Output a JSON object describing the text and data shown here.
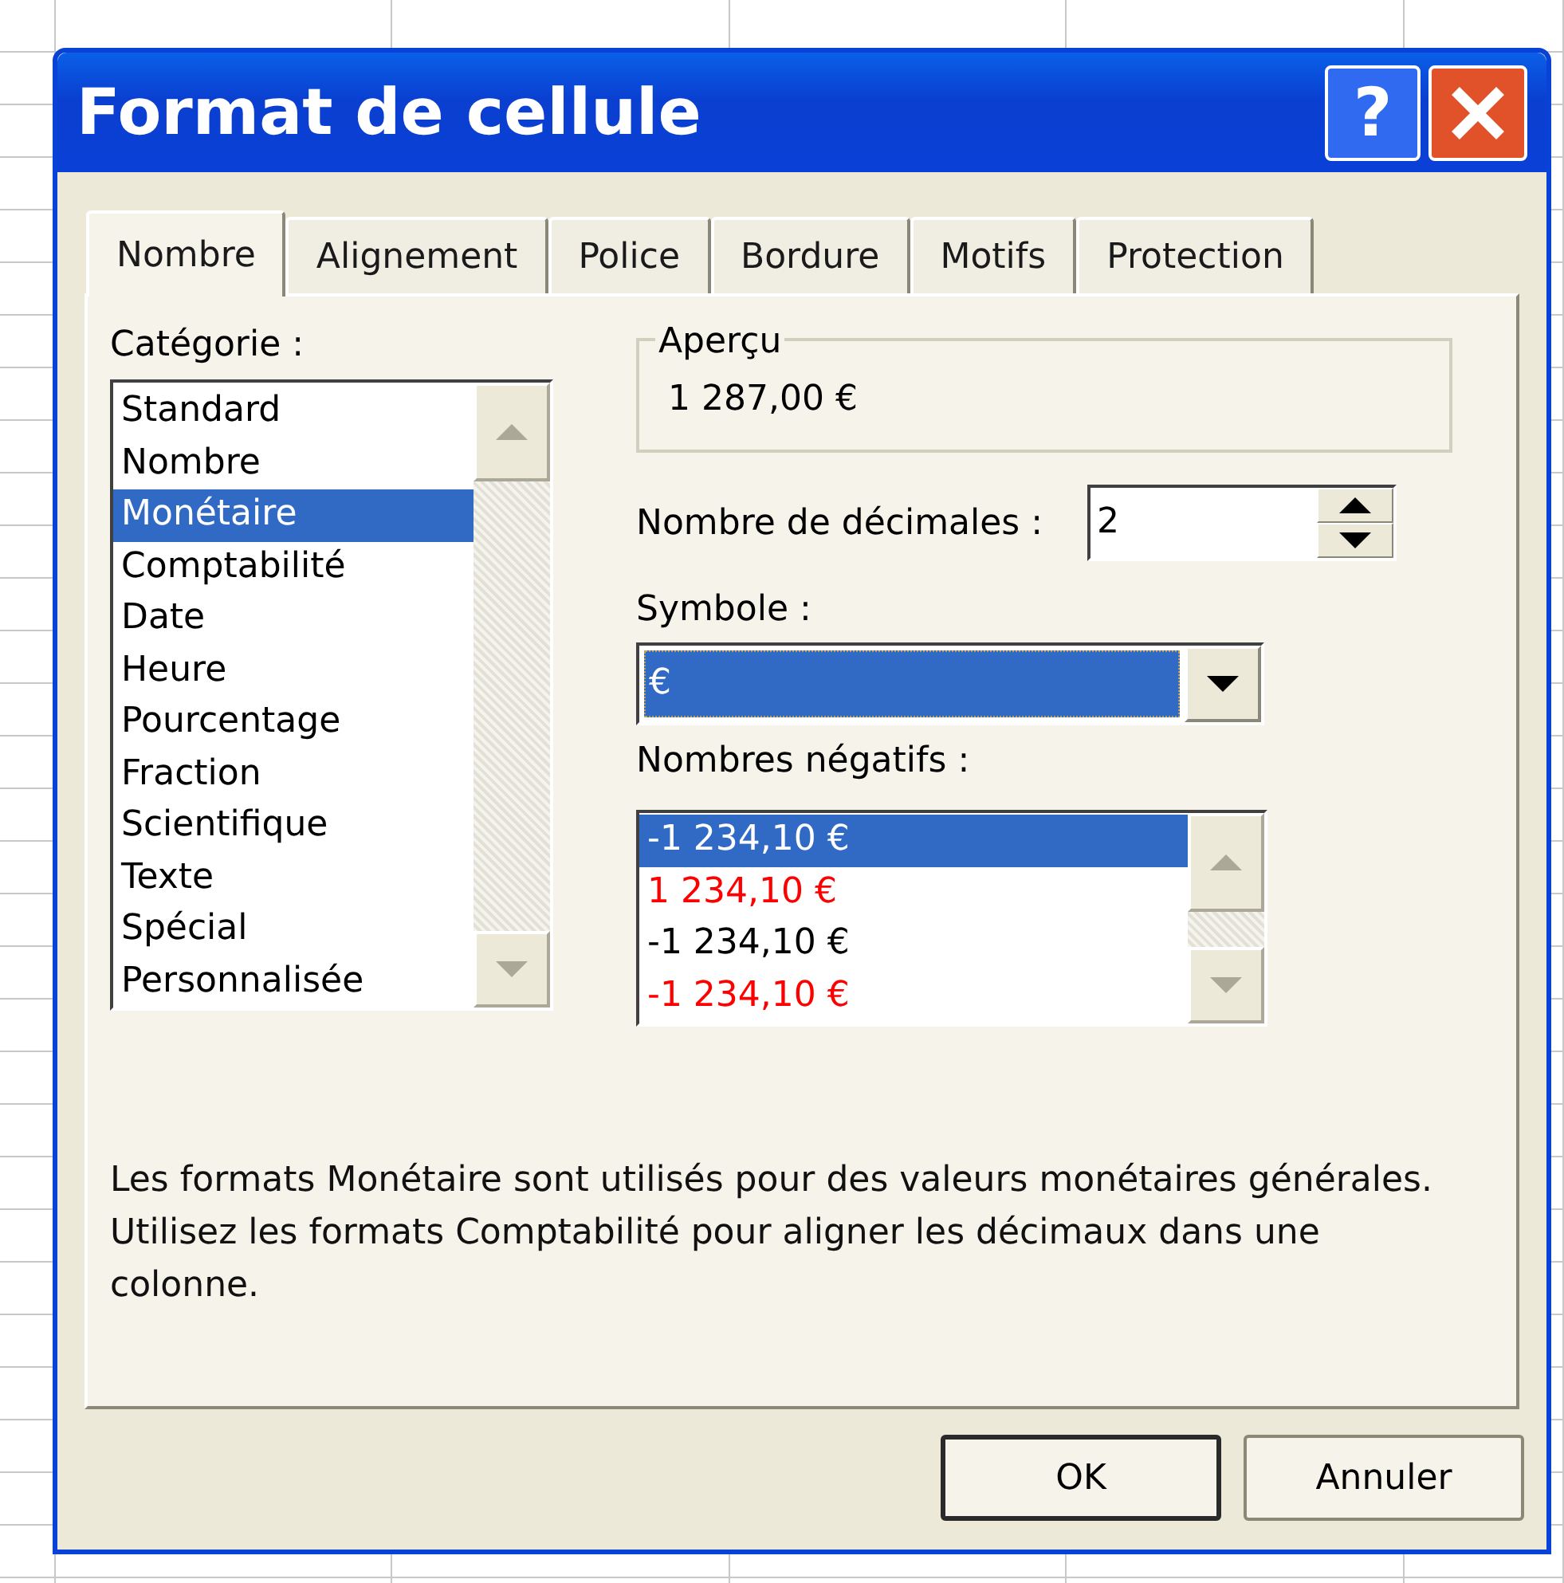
{
  "window": {
    "title": "Format de cellule",
    "help_button": "?"
  },
  "tabs": [
    {
      "label": "Nombre",
      "selected": true
    },
    {
      "label": "Alignement",
      "selected": false
    },
    {
      "label": "Police",
      "selected": false
    },
    {
      "label": "Bordure",
      "selected": false
    },
    {
      "label": "Motifs",
      "selected": false
    },
    {
      "label": "Protection",
      "selected": false
    }
  ],
  "category": {
    "label": "Catégorie :",
    "items": [
      {
        "label": "Standard",
        "selected": false
      },
      {
        "label": "Nombre",
        "selected": false
      },
      {
        "label": "Monétaire",
        "selected": true
      },
      {
        "label": "Comptabilité",
        "selected": false
      },
      {
        "label": "Date",
        "selected": false
      },
      {
        "label": "Heure",
        "selected": false
      },
      {
        "label": "Pourcentage",
        "selected": false
      },
      {
        "label": "Fraction",
        "selected": false
      },
      {
        "label": "Scientifique",
        "selected": false
      },
      {
        "label": "Texte",
        "selected": false
      },
      {
        "label": "Spécial",
        "selected": false
      },
      {
        "label": "Personnalisée",
        "selected": false
      }
    ]
  },
  "preview": {
    "label": "Aperçu",
    "value": "1 287,00 €"
  },
  "decimals": {
    "label": "Nombre de décimales :",
    "value": "2"
  },
  "symbol": {
    "label": "Symbole :",
    "value": "€"
  },
  "negative_numbers": {
    "label": "Nombres négatifs :",
    "items": [
      {
        "label": "-1 234,10 €",
        "selected": true
      },
      {
        "label": "1 234,10 €",
        "color": "#ff0000",
        "selected": false
      },
      {
        "label": "-1 234,10 €",
        "color": "#000000",
        "selected": false
      },
      {
        "label": "-1 234,10 €",
        "color": "#ff0000",
        "selected": false
      }
    ]
  },
  "description": "Les formats Monétaire sont utilisés pour des valeurs monétaires générales. Utilisez les formats Comptabilité pour aligner les décimaux dans une colonne.",
  "buttons": [
    {
      "label": "OK",
      "default": true
    },
    {
      "label": "Annuler",
      "default": false
    }
  ]
}
